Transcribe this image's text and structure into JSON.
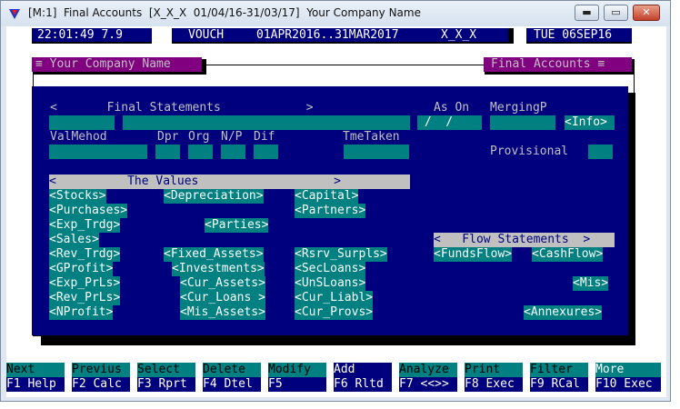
{
  "window": {
    "title": "[M:1]  Final Accounts  [X_X_X  01/04/16-31/03/17]  Your Company Name",
    "min_label": "▬",
    "max_label": "▭",
    "close_label": "✕"
  },
  "status_bar": {
    "clock": "22:01:49 7.9",
    "mode": "VOUCH",
    "period": "01APR2016..31MAR2017",
    "code": "X_X_X",
    "date": "TUE 06SEP16"
  },
  "headers": {
    "company": "≡ Your Company Name",
    "module": "Final Accounts ≡"
  },
  "form": {
    "final_statements": "<       Final Statements            >",
    "as_on": "As On",
    "merging": "MergingP",
    "as_on_value": " /  /",
    "info": "<Info>",
    "valmethod": "ValMehod",
    "dpr": "Dpr",
    "org": "Org",
    "np": "N/P",
    "dif": "Dif",
    "tmetaken": "TmeTaken",
    "provisional": "Provisional"
  },
  "values_section": {
    "header": "<          The Values                   >",
    "buttons": {
      "stocks": "<Stocks>",
      "purchases": "<Purchases>",
      "exp_trdg": "<Exp_Trdg>",
      "sales": "<Sales>",
      "rev_trdg": "<Rev_Trdg>",
      "gprofit": "<GProfit>",
      "exp_prls": "<Exp_PrLs>",
      "rev_prls": "<Rev_PrLs>",
      "nprofit": "<NProfit>",
      "depreciation": "<Depreciation>",
      "parties": "<Parties>",
      "fixed_assets": "<Fixed_Assets>",
      "investments": "<Investments>",
      "cur_assets": "<Cur_Assets>",
      "cur_loans": "<Cur_Loans >",
      "mis_assets": "<Mis_Assets>",
      "capital": "<Capital>",
      "partners": "<Partners>",
      "rsrv_surpls": "<Rsrv_Surpls>",
      "secloans": "<SecLoans>",
      "unsloans": "<UnSLoans>",
      "cur_liabl": "<Cur_Liabl>",
      "cur_provs": "<Cur_Provs>"
    }
  },
  "flow_section": {
    "header": "<   Flow Statements  >",
    "fundsflow": "<FundsFlow>",
    "cashflow": "<CashFlow>",
    "mis": "<Mis>",
    "annexures": "<Annexures>"
  },
  "fkeys": {
    "top": [
      "Next",
      "Previus",
      "Select",
      "Delete",
      "Modify",
      "Add",
      "Analyze",
      "Print",
      "Filter",
      "More"
    ],
    "bottom": [
      "F1 Help",
      "F2 Calc",
      "F3 Rprt",
      "F4 Dtel",
      "F5",
      "F6 Rltd",
      "F7 <<>>",
      "F8 Exec",
      "F9 RCal",
      "F10 Exec"
    ]
  },
  "colors": {
    "navy": "#00007f",
    "teal": "#008080",
    "gray": "#c0c0c0",
    "magenta": "#800080"
  }
}
